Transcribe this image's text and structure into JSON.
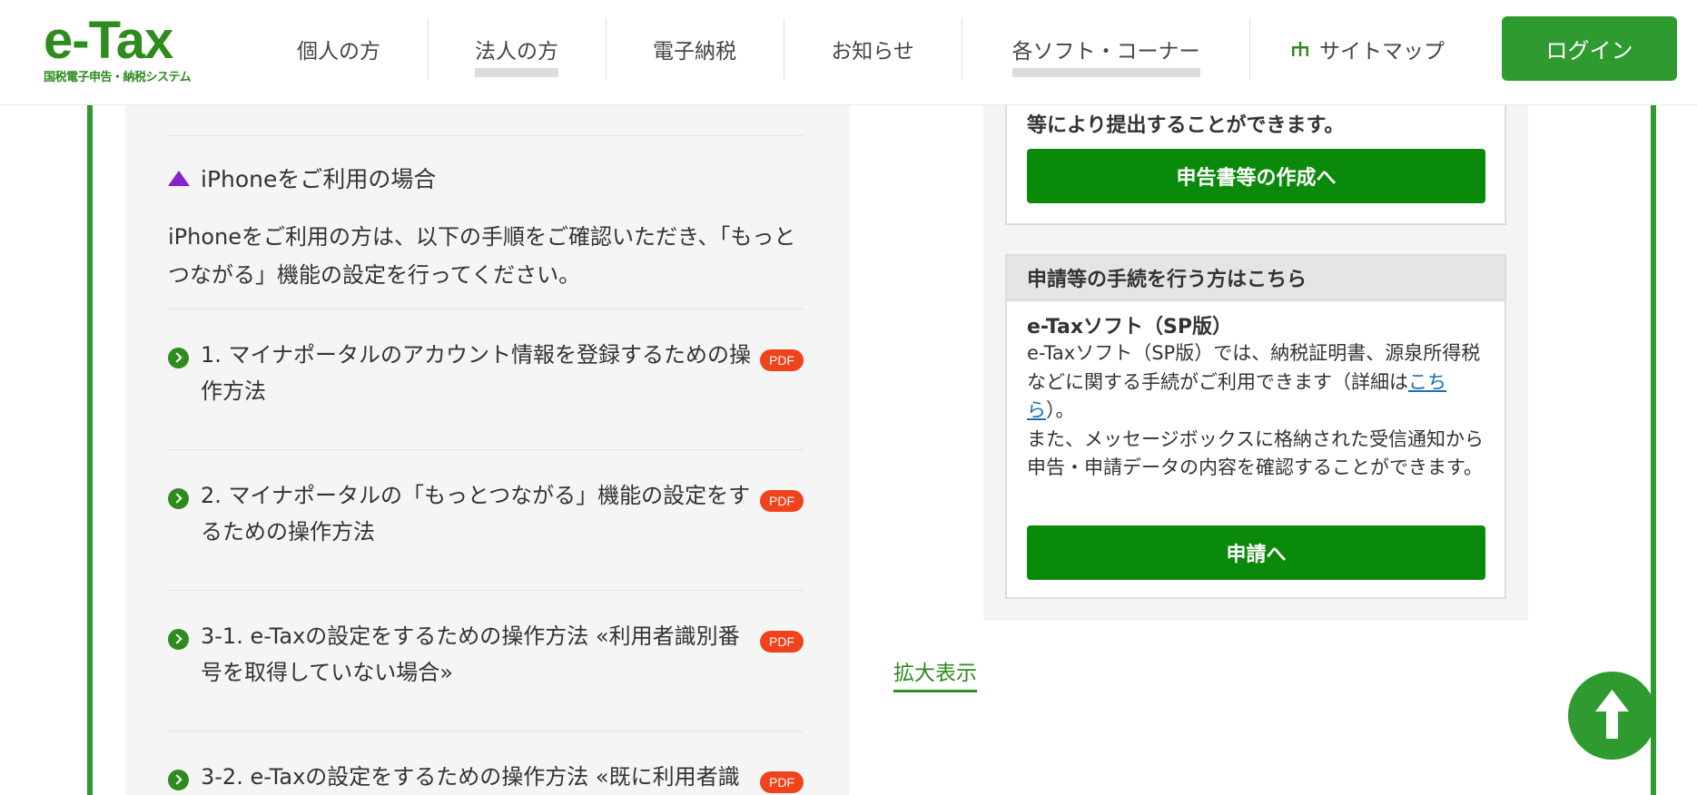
{
  "header": {
    "logo_main": "e-Tax",
    "logo_sub": "国税電子申告・納税システム",
    "nav": [
      {
        "label": "個人の方"
      },
      {
        "label": "法人の方"
      },
      {
        "label": "電子納税"
      },
      {
        "label": "お知らせ"
      },
      {
        "label": "各ソフト・コーナー"
      }
    ],
    "sitemap_label": "サイトマップ",
    "login_label": "ログイン"
  },
  "left": {
    "heading": "iPhoneをご利用の場合",
    "description": "iPhoneをご利用の方は、以下の手順をご確認いただき、「もっとつながる」機能の設定を行ってください。",
    "items": [
      {
        "text": "1. マイナポータルのアカウント情報を登録するための操作方法",
        "badge": "PDF"
      },
      {
        "text": "2. マイナポータルの「もっとつながる」機能の設定をするための操作方法",
        "badge": "PDF"
      },
      {
        "text": "3-1. e-Taxの設定をするための操作方法 «利用者識別番号を取得していない場合»",
        "badge": "PDF"
      },
      {
        "text": "3-2. e-Taxの設定をするための操作方法 «既に利用者識",
        "badge": "PDF"
      }
    ]
  },
  "right": {
    "box1_text": "等により提出することができます。",
    "box1_button": "申告書等の作成へ",
    "box2_heading": "申請等の手続を行う方はこちら",
    "box2_subtitle": "e-Taxソフト（SP版）",
    "box2_body_1": "e-Taxソフト（SP版）では、納税証明書、源泉所得税などに関する手続がご利用できます（詳細は",
    "box2_link": "こちら",
    "box2_body_2": "）。",
    "box2_body_3": "また、メッセージボックスに格納された受信通知から申告・申請データの内容を確認することができます。",
    "box2_button": "申請へ"
  },
  "zoom_label": "拡大表示",
  "icons": {
    "bullet": "triangle-icon",
    "item": "chevron-right-circle-icon",
    "sitemap": "sitemap-icon",
    "scroll_top": "arrow-up-icon"
  },
  "colors": {
    "brand_green": "#2f9a2f",
    "button_green": "#0a8a0a",
    "pdf_red": "#f0431d",
    "bullet_purple": "#8a1fd0",
    "link_blue": "#1a6fb0"
  }
}
